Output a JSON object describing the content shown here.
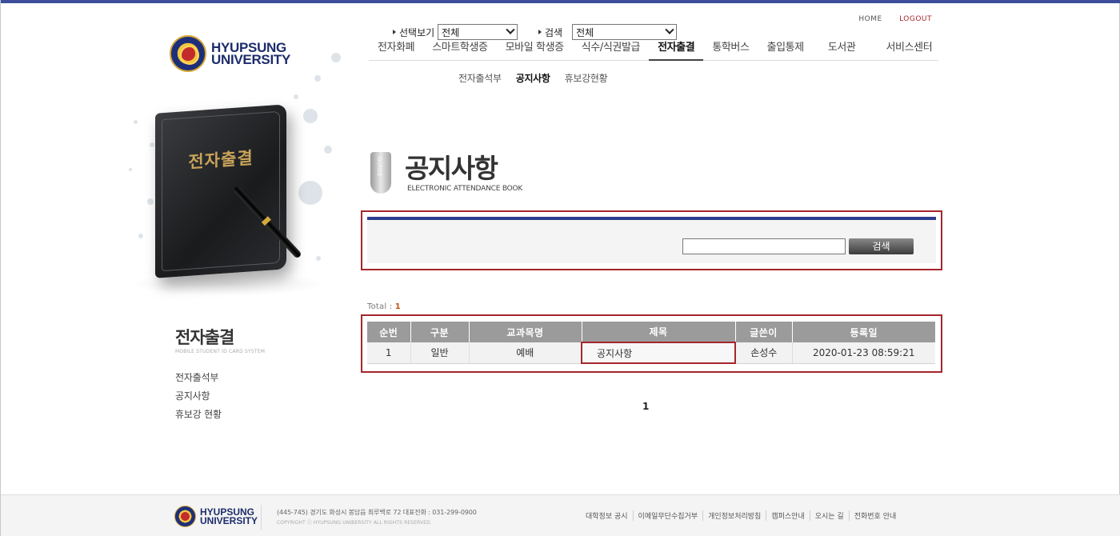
{
  "header": {
    "util_links": [
      "HOME",
      "LOGOUT"
    ],
    "logo_line1": "HYUPSUNG",
    "logo_line2": "UNIVERSITY",
    "gnb": [
      "전자화폐",
      "스마트학생증",
      "모바일 학생증",
      "식수/식권발급",
      "전자출결",
      "통학버스",
      "출입통제",
      "도서관",
      "서비스센터"
    ],
    "gnb_active": "전자출결",
    "lnb": [
      "전자출석부",
      "공지사항",
      "휴보강현황"
    ],
    "lnb_active": "공지사항"
  },
  "visual": {
    "book_title": "전자출결"
  },
  "sidebar": {
    "title": "전자출결",
    "subtitle": "MOBILE STUDENT ID CARD SYSTEM",
    "items": [
      "전자출석부",
      "공지사항",
      "휴보강 현황"
    ]
  },
  "page": {
    "guide_label": "GUIDE",
    "title": "공지사항",
    "subtitle": "ELECTRONIC ATTENDANCE BOOK"
  },
  "search": {
    "view_label": "선택보기",
    "view_selected": "전체",
    "search_label": "검색",
    "search_selected": "전체",
    "keyword_value": "",
    "button_label": "검색"
  },
  "list": {
    "total_label": "Total :",
    "total_count": "1",
    "columns": [
      "순번",
      "구분",
      "교과목명",
      "제목",
      "글쓴이",
      "등록일"
    ],
    "rows": [
      [
        "1",
        "일반",
        "예배",
        "공지사항",
        "손성수",
        "2020-01-23 08:59:21"
      ]
    ]
  },
  "pagination": {
    "current": "1"
  },
  "footer": {
    "logo_line1": "HYUPSUNG",
    "logo_line2": "UNIVERSITY",
    "address": "(445-745) 경기도 화성시 봉담읍 최루백로 72   대표전화 : 031-299-0900",
    "copyright": "COPYRIGHT ⓒ HYUPSUNG UNIBERSITY ALL RIGHTS RESERVED.",
    "links": [
      "대학정보 공시",
      "이메일무단수집거부",
      "개인정보처리방침",
      "캠퍼스안내",
      "오시는 길",
      "전화번호 안내"
    ]
  },
  "colors": {
    "accent_blue": "#2d3d8d",
    "highlight_red": "#a4262c",
    "table_header": "#9b9b9b"
  }
}
